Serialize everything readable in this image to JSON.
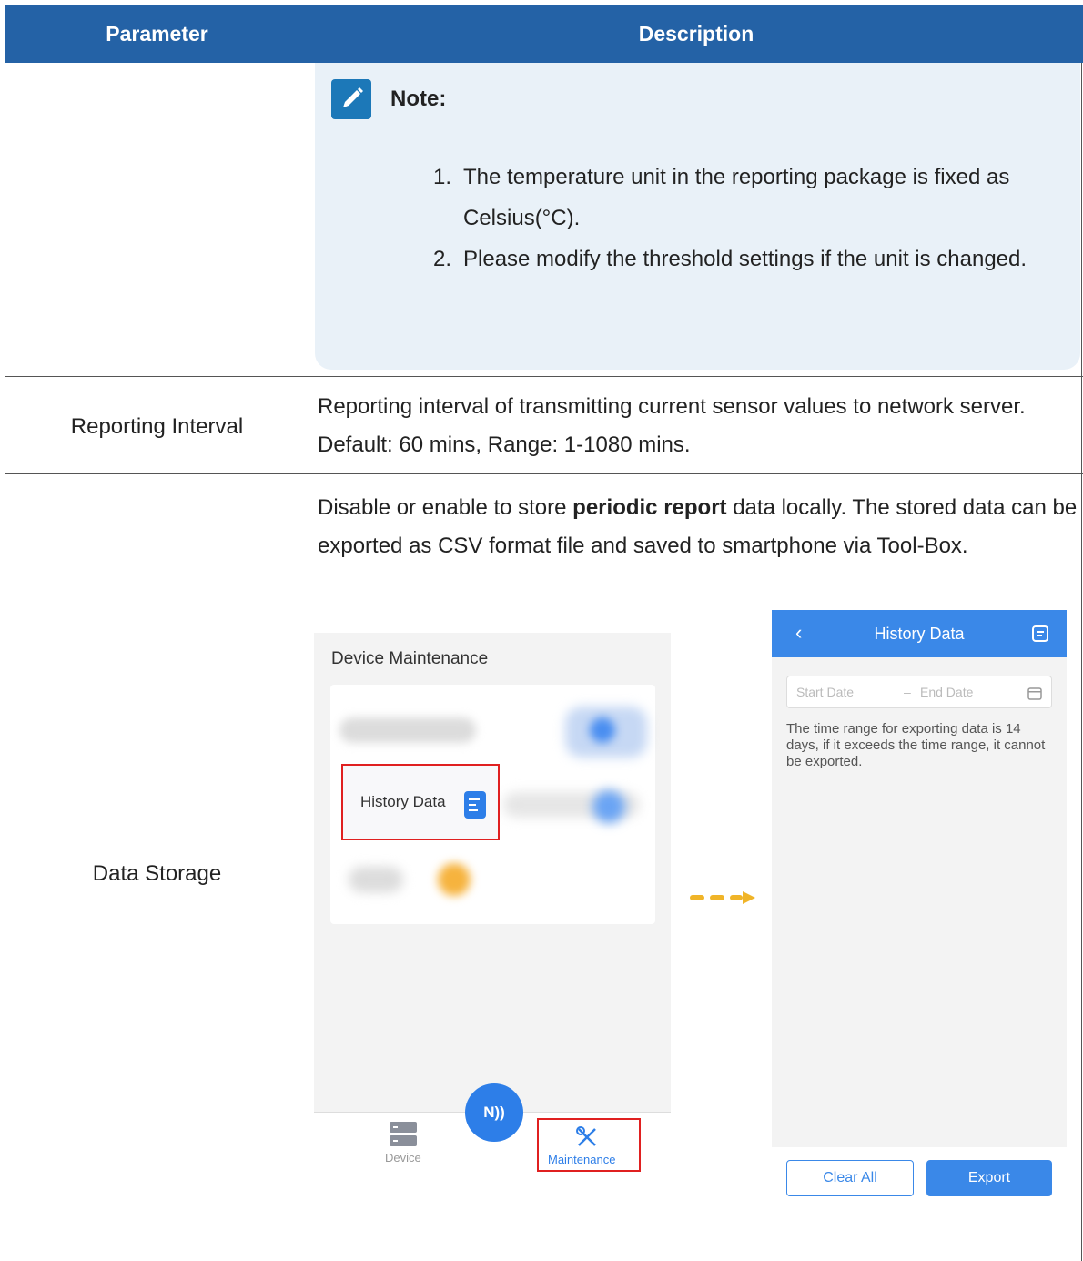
{
  "table": {
    "headers": [
      "Parameter",
      "Description"
    ]
  },
  "note": {
    "title": "Note:",
    "items": [
      {
        "num": "1.",
        "text": "The temperature unit in the reporting package is fixed as Celsius(°C)."
      },
      {
        "num": "2.",
        "text": "Please modify the threshold settings if the unit is changed."
      }
    ]
  },
  "rows": [
    {
      "param": "Reporting Interval",
      "desc": "Reporting interval of transmitting current sensor values to network server. Default: 60 mins, Range: 1-1080 mins."
    },
    {
      "param": "Data Storage",
      "desc_pre": "Disable or enable to store ",
      "desc_bold": "periodic report",
      "desc_post": " data locally. The stored data can be exported as CSV format file and saved to smartphone via Tool-Box."
    }
  ],
  "app_left": {
    "title": "Device Maintenance",
    "history_label": "History Data",
    "nfc_label": "N))",
    "tab_device": "Device",
    "tab_maintenance": "Maintenance"
  },
  "app_right": {
    "title": "History Data",
    "back_icon": "chevron-left-icon",
    "start_placeholder": "Start Date",
    "end_placeholder": "End Date",
    "info": "The time range for exporting data is 14 days, if it exceeds the time range, it cannot be exported.",
    "clear_label": "Clear All",
    "export_label": "Export"
  },
  "colors": {
    "header_bg": "#2462a6",
    "note_bg": "#e9f1f8",
    "accent": "#3a88e8",
    "highlight": "#e02020",
    "arrow": "#f0b428"
  }
}
